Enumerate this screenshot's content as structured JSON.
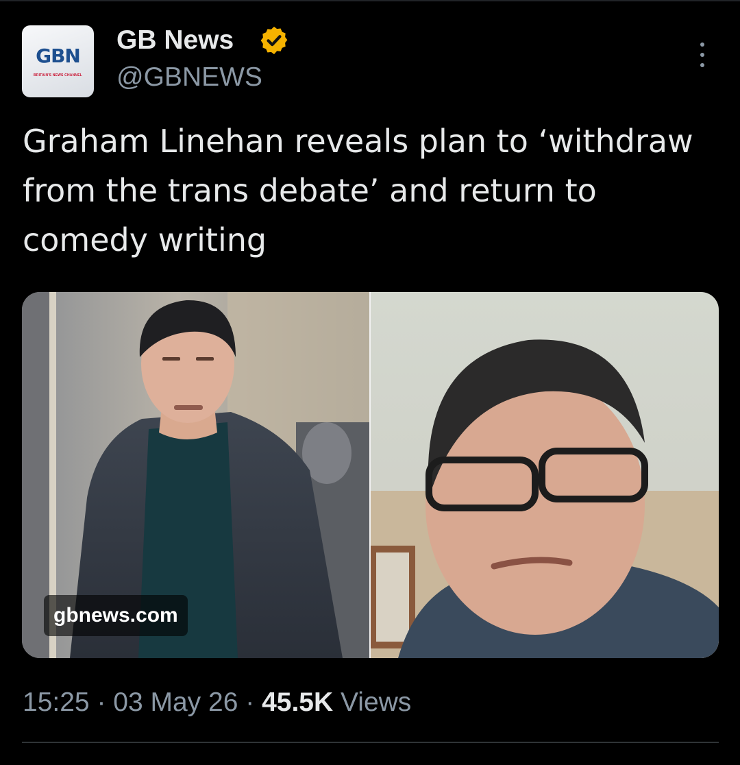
{
  "account": {
    "display_name": "GB News",
    "handle": "@GBNEWS",
    "avatar_logo_text": "GBN",
    "avatar_tagline": "BRITAIN'S NEWS CHANNEL",
    "verified_icon": "verified-badge-icon",
    "badge_color": "#f5b200"
  },
  "more_icon": "more-vertical-icon",
  "tweet": {
    "text": "Graham Linehan reveals plan to ‘withdraw from the trans debate’ and return to comedy writing"
  },
  "media": {
    "card_source": "gbnews.com"
  },
  "meta": {
    "time": "15:25",
    "separator": " · ",
    "date": "03 May 26",
    "views_count": "45.5K",
    "views_label": " Views"
  }
}
